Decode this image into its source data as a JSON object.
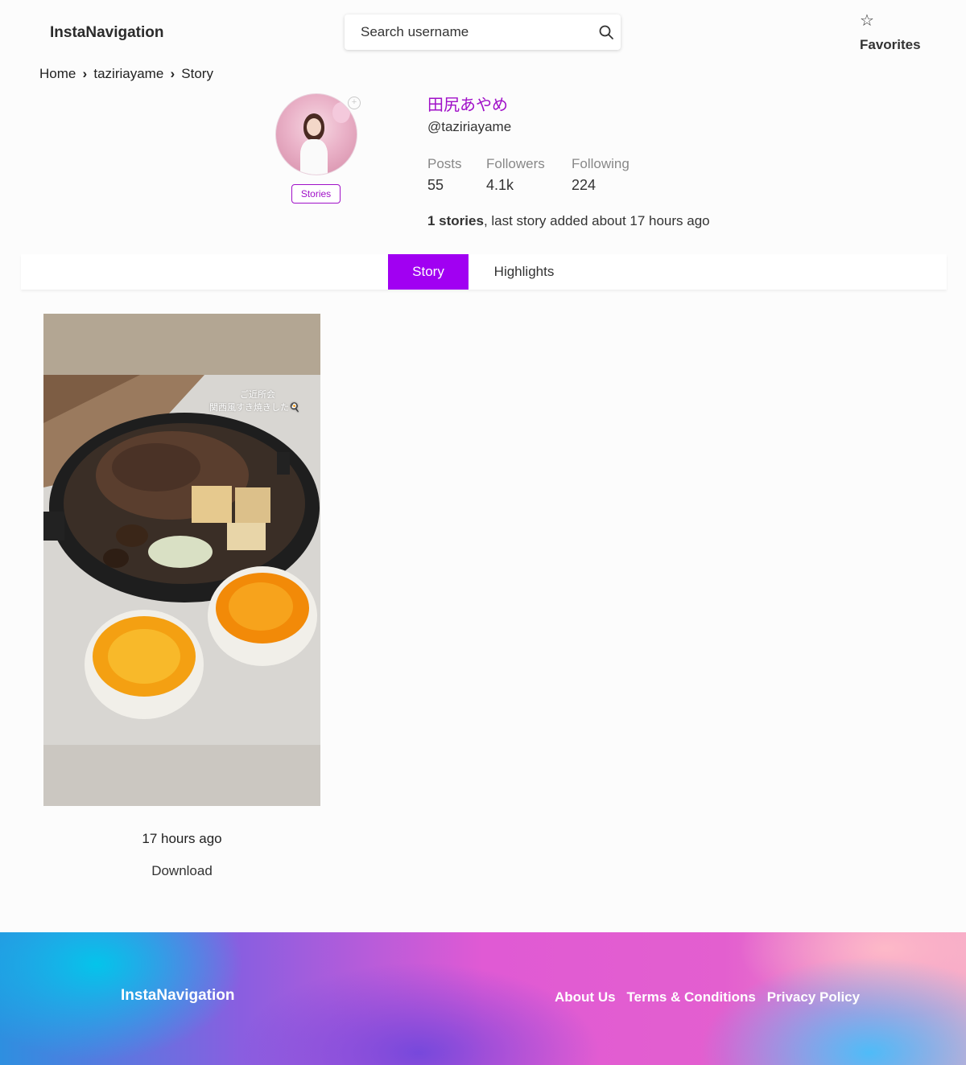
{
  "header": {
    "logo": "InstaNavigation",
    "search_placeholder": "Search username",
    "favorites_label": "Favorites"
  },
  "breadcrumb": {
    "home": "Home",
    "user": "taziriayame",
    "current": "Story"
  },
  "profile": {
    "name": "田尻あやめ",
    "handle": "@taziriayame",
    "stories_button": "Stories",
    "stats": [
      {
        "label": "Posts",
        "value": "55"
      },
      {
        "label": "Followers",
        "value": "4.1k"
      },
      {
        "label": "Following",
        "value": "224"
      }
    ],
    "stories_count": "1 stories",
    "stories_suffix": ", last story added about 17 hours ago"
  },
  "tabs": {
    "story": "Story",
    "highlights": "Highlights"
  },
  "story": {
    "caption_line1": "ご近所会",
    "caption_line2": "関西風すき焼きした🍳",
    "time": "17 hours ago",
    "download": "Download"
  },
  "footer": {
    "logo": "InstaNavigation",
    "links": [
      "About Us",
      "Terms & Conditions",
      "Privacy Policy"
    ]
  },
  "colors": {
    "accent": "#a100f2",
    "name": "#a010c8"
  }
}
